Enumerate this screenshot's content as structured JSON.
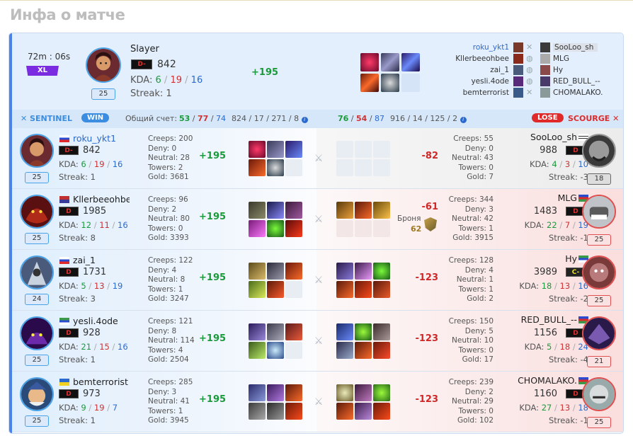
{
  "title": "Инфа о матче",
  "mvp": {
    "duration": "72m : 06s",
    "badge": "XL",
    "name": "Slayer",
    "rank": "D-",
    "mmr": "842",
    "kda_label": "KDA:",
    "kills": "6",
    "deaths": "19",
    "assists": "16",
    "streak": "Streak: 1",
    "level": "25",
    "gain": "+195"
  },
  "pairs": [
    {
      "left": "roku_ykt1",
      "right": "SooLoo_sh"
    },
    {
      "left": "Kllerbeeohbee",
      "right": "MLG"
    },
    {
      "left": "zai_1",
      "right": "Hy"
    },
    {
      "left": "yesli.4ode",
      "right": "RED_BULL_--"
    },
    {
      "left": "bemterrorist",
      "right": "CHOMALAKO."
    }
  ],
  "header": {
    "sentinel": "SENTINEL",
    "win": "WIN",
    "score_label": "Общий счет:",
    "s_kills": "53",
    "s_deaths": "77",
    "s_assists": "74",
    "s_stats": "824 / 17 / 271 / 8",
    "c_kills": "76",
    "c_deaths": "54",
    "c_assists": "87",
    "c_stats": "916 / 14 / 125 / 2",
    "lose": "LOSE",
    "scourge": "SCOURGE"
  },
  "rows": [
    {
      "l": {
        "name": "roku_ykt1",
        "rank": "D-",
        "mmr": "842",
        "k": "6",
        "d": "19",
        "a": "16",
        "streak": "Streak: 1",
        "level": "25",
        "creeps": "Creeps: 200",
        "deny": "Deny: 0",
        "neutral": "Neutral: 28",
        "towers": "Towers: 2",
        "gold": "Gold: 3681",
        "delta": "+195"
      },
      "r": {
        "name": "SooLoo_sh",
        "rank": "D",
        "mmr": "988",
        "k": "4",
        "d": "3",
        "a": "10",
        "streak": "Streak: -3",
        "level": "18",
        "creeps": "Creeps: 55",
        "deny": "Deny: 0",
        "neutral": "Neutral: 43",
        "towers": "Towers: 0",
        "gold": "Gold: 7",
        "delta": "-82"
      }
    },
    {
      "l": {
        "name": "Kllerbeeohbee",
        "rank": "D",
        "mmr": "1985",
        "k": "12",
        "d": "11",
        "a": "16",
        "streak": "Streak: 8",
        "level": "25",
        "creeps": "Creeps: 96",
        "deny": "Deny: 2",
        "neutral": "Neutral: 80",
        "towers": "Towers: 0",
        "gold": "Gold: 3393",
        "delta": "+195"
      },
      "r": {
        "name": "MLG",
        "rank": "D",
        "mmr": "1483",
        "k": "22",
        "d": "7",
        "a": "19",
        "streak": "Streak: -1",
        "level": "25",
        "creeps": "Creeps: 344",
        "deny": "Deny: 3",
        "neutral": "Neutral: 42",
        "towers": "Towers: 1",
        "gold": "Gold: 3915",
        "delta": "-61",
        "armor_label": "Броня",
        "armor": "62"
      }
    },
    {
      "l": {
        "name": "zai_1",
        "rank": "D",
        "mmr": "1731",
        "k": "5",
        "d": "13",
        "a": "19",
        "streak": "Streak: 3",
        "level": "24",
        "creeps": "Creeps: 122",
        "deny": "Deny: 4",
        "neutral": "Neutral: 8",
        "towers": "Towers: 1",
        "gold": "Gold: 3247",
        "delta": "+195"
      },
      "r": {
        "name": "Hy",
        "rank": "C-",
        "mmr": "3989",
        "k": "18",
        "d": "13",
        "a": "16",
        "streak": "Streak: -2",
        "level": "25",
        "creeps": "Creeps: 128",
        "deny": "Deny: 4",
        "neutral": "Neutral: 1",
        "towers": "Towers: 1",
        "gold": "Gold: 2",
        "delta": "-123"
      }
    },
    {
      "l": {
        "name": "yesli.4ode",
        "rank": "D",
        "mmr": "928",
        "k": "21",
        "d": "15",
        "a": "16",
        "streak": "Streak: 1",
        "level": "25",
        "creeps": "Creeps: 121",
        "deny": "Deny: 8",
        "neutral": "Neutral: 114",
        "towers": "Towers: 4",
        "gold": "Gold: 2504",
        "delta": "+195"
      },
      "r": {
        "name": "RED_BULL_--",
        "rank": "D",
        "mmr": "1156",
        "k": "5",
        "d": "18",
        "a": "24",
        "streak": "Streak: -4",
        "level": "21",
        "creeps": "Creeps: 150",
        "deny": "Deny: 5",
        "neutral": "Neutral: 10",
        "towers": "Towers: 0",
        "gold": "Gold: 17",
        "delta": "-123"
      }
    },
    {
      "l": {
        "name": "bemterrorist",
        "rank": "D",
        "mmr": "973",
        "k": "9",
        "d": "19",
        "a": "7",
        "streak": "Streak: 1",
        "level": "25",
        "creeps": "Creeps: 285",
        "deny": "Deny: 3",
        "neutral": "Neutral: 41",
        "towers": "Towers: 1",
        "gold": "Gold: 3945",
        "delta": "+195"
      },
      "r": {
        "name": "CHOMALAKO.",
        "rank": "D",
        "mmr": "1160",
        "k": "27",
        "d": "13",
        "a": "18",
        "streak": "Streak: -1",
        "level": "25",
        "creeps": "Creeps: 239",
        "deny": "Deny: 2",
        "neutral": "Neutral: 29",
        "towers": "Towers: 0",
        "gold": "Gold: 102",
        "delta": "-123"
      }
    }
  ],
  "kda_label": "KDA:"
}
